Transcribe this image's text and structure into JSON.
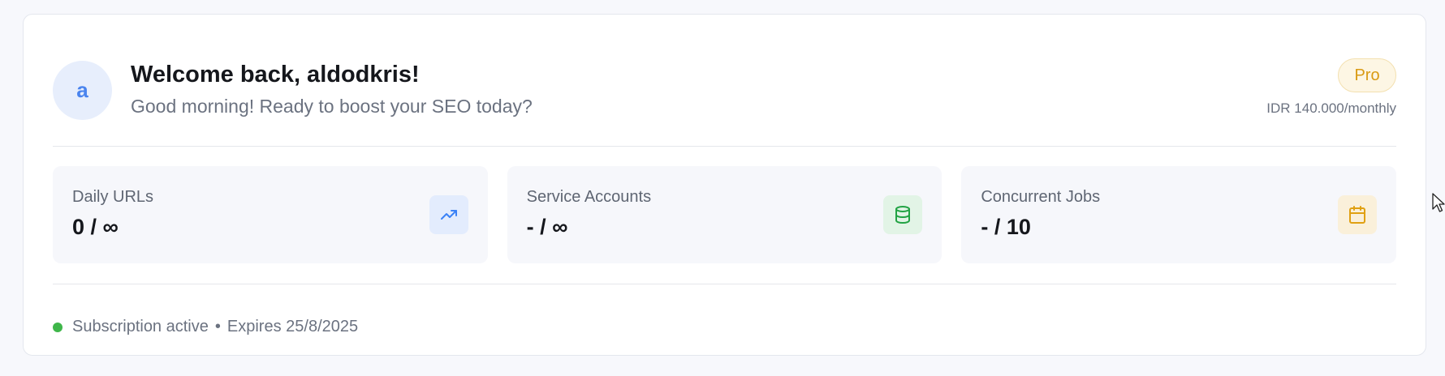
{
  "user": {
    "avatar_letter": "a",
    "welcome": "Welcome back, aldodkris!",
    "greeting": "Good morning! Ready to boost your SEO today?"
  },
  "plan": {
    "name": "Pro",
    "price": "IDR 140.000/monthly"
  },
  "stats": [
    {
      "label": "Daily URLs",
      "value": "0 / ∞",
      "icon": "trending-up-icon",
      "icon_color": "#3b82f6",
      "icon_bg": "#e3ecfd"
    },
    {
      "label": "Service Accounts",
      "value": "- / ∞",
      "icon": "database-icon",
      "icon_color": "#22a344",
      "icon_bg": "#e2f4e6"
    },
    {
      "label": "Concurrent Jobs",
      "value": "- / 10",
      "icon": "calendar-icon",
      "icon_color": "#e0a012",
      "icon_bg": "#faf0da"
    }
  ],
  "subscription": {
    "status": "Subscription active",
    "separator": "•",
    "expires": "Expires 25/8/2025",
    "status_color": "#3fb64a"
  },
  "colors": {
    "accent": "#4a84ee",
    "pro_badge": "#d99a13"
  }
}
